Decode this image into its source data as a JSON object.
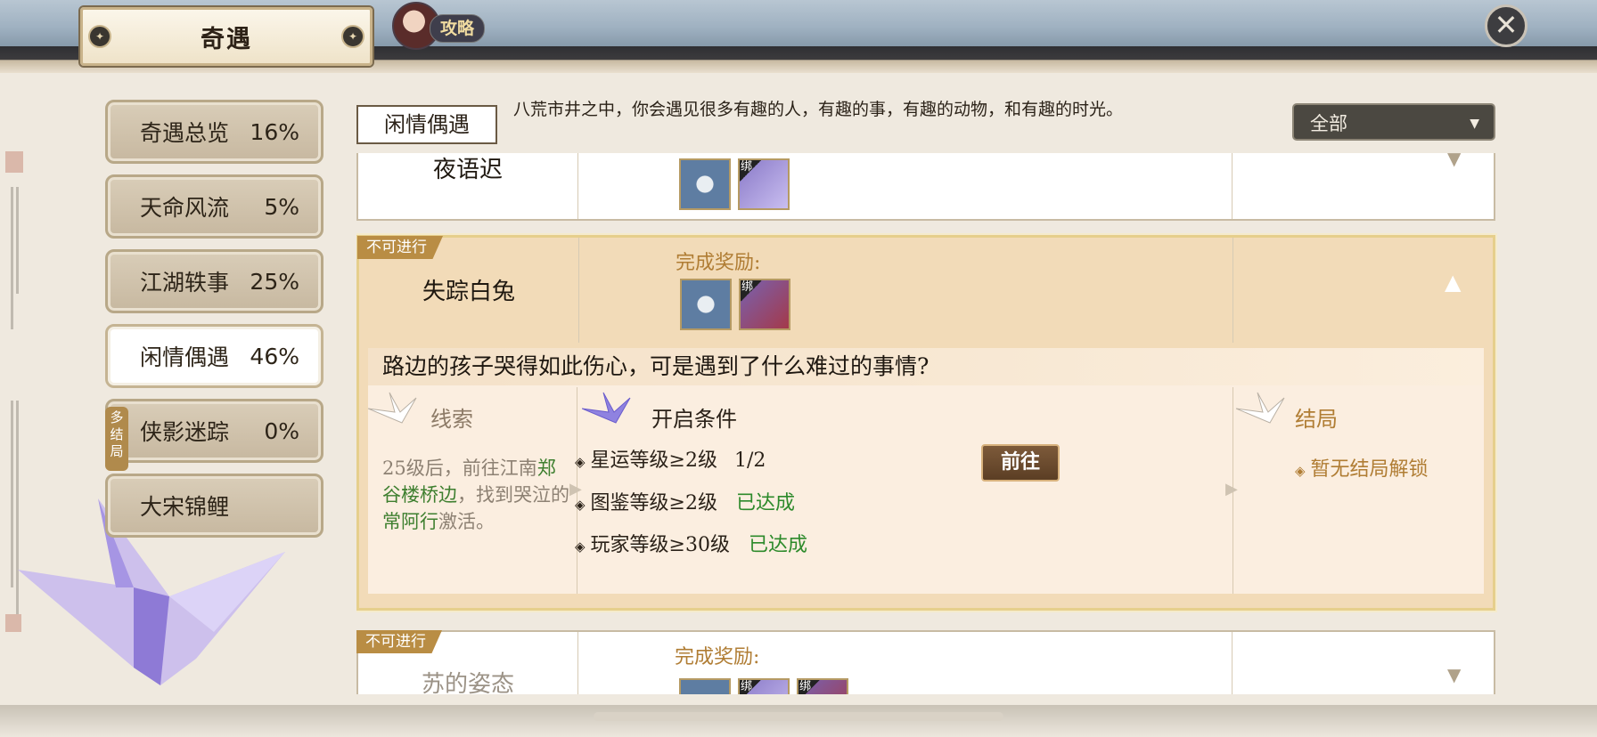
{
  "header": {
    "title": "奇遇",
    "guide_label": "攻略",
    "close_label": "✕"
  },
  "sidebar": {
    "items": [
      {
        "label": "奇遇总览",
        "percent": "16%"
      },
      {
        "label": "天命风流",
        "percent": "5%"
      },
      {
        "label": "江湖轶事",
        "percent": "25%"
      },
      {
        "label": "闲情偶遇",
        "percent": "46%",
        "active": true
      },
      {
        "label": "侠影迷踪",
        "percent": "0%",
        "badge": "多结局"
      },
      {
        "label": "大宋锦鲤",
        "percent": ""
      }
    ]
  },
  "category": {
    "name": "闲情偶遇",
    "description": "八荒市井之中，你会遇见很多有趣的人，有趣的事，有趣的动物，和有趣的时光。"
  },
  "filter": {
    "selected": "全部"
  },
  "cards": [
    {
      "name": "夜语迟",
      "bind_tag": "绑"
    },
    {
      "status": "不可进行",
      "name": "失踪白兔",
      "reward_label": "完成奖励:",
      "bind_tag": "绑",
      "question": "路边的孩子哭得如此伤心，可是遇到了什么难过的事情?",
      "clue_title": "线索",
      "clue_text_1": "25级后，前往江南",
      "clue_place": "郑谷楼桥边",
      "clue_text_2": "，找到哭泣的",
      "clue_person": "常阿行",
      "clue_text_3": "激活。",
      "cond_title": "开启条件",
      "conditions": [
        {
          "text": "星运等级≥2级",
          "progress": "1/2",
          "state": ""
        },
        {
          "text": "图鉴等级≥2级",
          "progress": "",
          "state": "已达成"
        },
        {
          "text": "玩家等级≥30级",
          "progress": "",
          "state": "已达成"
        }
      ],
      "goto_label": "前往",
      "ending_title": "结局",
      "ending_text": "暂无结局解锁"
    },
    {
      "status": "不可进行",
      "name": "苏的姿态",
      "reward_label": "完成奖励:",
      "bind_tag": "绑"
    }
  ],
  "colors": {
    "accent_gold": "#b07d34",
    "achieved_green": "#2d8a2b",
    "status_tag": "#b98d44"
  },
  "icons": [
    "close-icon",
    "dropdown-caret-icon",
    "paper-crane-icon",
    "orb-icon",
    "scroll-icon",
    "sachet-icon"
  ]
}
